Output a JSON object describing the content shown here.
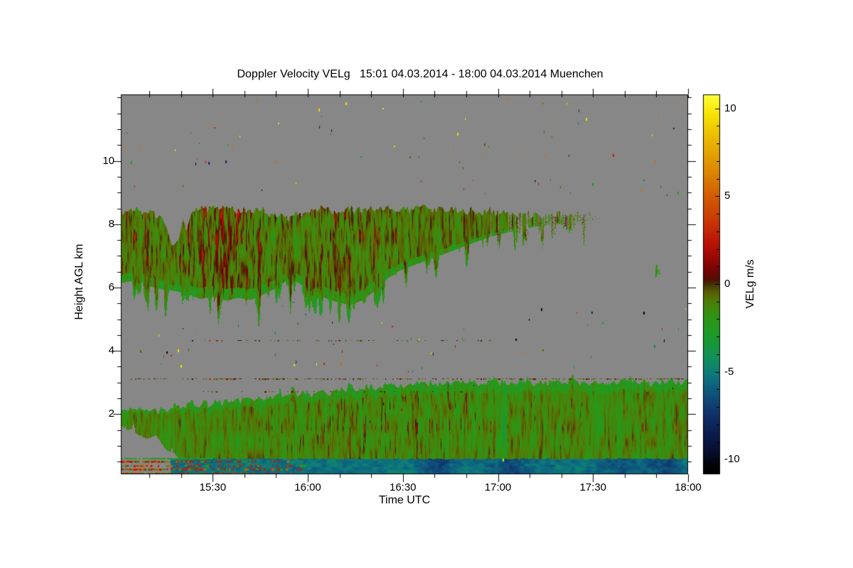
{
  "chart_data": {
    "type": "heatmap",
    "title": "Doppler Velocity VELg   15:01 04.03.2014 - 18:00 04.03.2014 Muenchen",
    "x_axis": {
      "label": "Time UTC",
      "start_time": "15:01",
      "end_time": "18:00",
      "duration_min": 179,
      "tick_labels": [
        "15:30",
        "16:00",
        "16:30",
        "17:00",
        "17:30",
        "18:00"
      ],
      "tick_min": [
        29,
        59,
        89,
        119,
        149,
        179
      ],
      "minor_step_min": 10
    },
    "y_axis": {
      "label": "Height AGL km",
      "min_km": 0.1,
      "max_km": 12.1,
      "tick_labels": [
        "2",
        "4",
        "6",
        "8",
        "10"
      ],
      "tick_km": [
        2,
        4,
        6,
        8,
        10
      ],
      "minor_step_km": 0.5
    },
    "colorbar": {
      "label": "VELg m/s",
      "vmin": -10.75,
      "vmax": 10.75,
      "tick_labels": [
        "10",
        "5",
        "0",
        "-5",
        "-10"
      ],
      "tick_values": [
        10,
        5,
        0,
        -5,
        -10
      ],
      "minor_step": 1
    },
    "no_data_color": "#878787",
    "colormap_stops": [
      [
        -10.75,
        "#000000"
      ],
      [
        -10.2,
        "#03040c"
      ],
      [
        -9.5,
        "#071030"
      ],
      [
        -8.5,
        "#0b1c4e"
      ],
      [
        -7.5,
        "#0f3068"
      ],
      [
        -6.5,
        "#0e4c78"
      ],
      [
        -5.5,
        "#0d6c80"
      ],
      [
        -5.0,
        "#0e7e76"
      ],
      [
        -4.2,
        "#11905c"
      ],
      [
        -3.4,
        "#16983a"
      ],
      [
        -2.6,
        "#1f9c22"
      ],
      [
        -1.8,
        "#2f9414"
      ],
      [
        -1.0,
        "#4f7e08"
      ],
      [
        -0.5,
        "#5a6203"
      ],
      [
        -0.15,
        "#4c4403"
      ],
      [
        0,
        "#452f08"
      ],
      [
        0.3,
        "#540e04"
      ],
      [
        0.8,
        "#740503"
      ],
      [
        1.6,
        "#9c0a04"
      ],
      [
        2.4,
        "#bc1406"
      ],
      [
        3.2,
        "#c62c07"
      ],
      [
        4.0,
        "#cc4204"
      ],
      [
        5.0,
        "#d25c00"
      ],
      [
        6.0,
        "#d97c00"
      ],
      [
        7.2,
        "#e29c00"
      ],
      [
        8.4,
        "#ecbc00"
      ],
      [
        9.6,
        "#f6e200"
      ],
      [
        10.75,
        "#ffff38"
      ]
    ],
    "layers": {
      "upper_cloud": {
        "t_end": 151,
        "fade_start": 113,
        "top_km": [
          [
            0,
            8.35
          ],
          [
            6,
            8.45
          ],
          [
            10,
            8.35
          ],
          [
            13,
            8.3
          ],
          [
            14.5,
            7.9
          ],
          [
            16,
            7.3
          ],
          [
            18,
            7.5
          ],
          [
            19.5,
            8.1
          ],
          [
            20.5,
            7.9
          ],
          [
            22,
            8.3
          ],
          [
            25,
            8.45
          ],
          [
            31,
            8.55
          ],
          [
            37,
            8.45
          ],
          [
            43,
            8.5
          ],
          [
            49,
            8.3
          ],
          [
            53,
            8.2
          ],
          [
            57,
            8.35
          ],
          [
            63,
            8.5
          ],
          [
            69,
            8.45
          ],
          [
            77,
            8.5
          ],
          [
            85,
            8.45
          ],
          [
            93,
            8.5
          ],
          [
            101,
            8.45
          ],
          [
            109,
            8.4
          ],
          [
            117,
            8.42
          ],
          [
            125,
            8.35
          ],
          [
            133,
            8.3
          ],
          [
            141,
            8.35
          ],
          [
            151,
            8.25
          ]
        ],
        "bottom_km": [
          [
            0,
            6.15
          ],
          [
            5,
            6.25
          ],
          [
            9,
            6.05
          ],
          [
            13,
            5.95
          ],
          [
            17,
            5.9
          ],
          [
            21,
            5.8
          ],
          [
            25,
            5.65
          ],
          [
            29,
            5.72
          ],
          [
            33,
            5.6
          ],
          [
            37,
            5.68
          ],
          [
            41,
            5.62
          ],
          [
            45,
            5.8
          ],
          [
            49,
            6.0
          ],
          [
            53,
            6.3
          ],
          [
            56,
            6.15
          ],
          [
            60,
            5.85
          ],
          [
            64,
            5.7
          ],
          [
            68,
            5.55
          ],
          [
            72,
            5.45
          ],
          [
            76,
            5.6
          ],
          [
            80,
            5.9
          ],
          [
            84,
            6.3
          ],
          [
            88,
            6.55
          ],
          [
            92,
            6.7
          ],
          [
            96,
            6.85
          ],
          [
            100,
            7.0
          ],
          [
            104,
            7.15
          ],
          [
            108,
            7.3
          ],
          [
            112,
            7.45
          ],
          [
            116,
            7.6
          ],
          [
            120,
            7.7
          ],
          [
            126,
            7.85
          ],
          [
            132,
            7.95
          ],
          [
            138,
            8.0
          ],
          [
            144,
            8.08
          ],
          [
            151,
            8.18
          ]
        ],
        "redness": [
          [
            0,
            0.55
          ],
          [
            8,
            0.62
          ],
          [
            14,
            0.45
          ],
          [
            18,
            0.5
          ],
          [
            24,
            0.68
          ],
          [
            30,
            0.75
          ],
          [
            36,
            0.72
          ],
          [
            42,
            0.6
          ],
          [
            48,
            0.42
          ],
          [
            54,
            0.38
          ],
          [
            58,
            0.5
          ],
          [
            64,
            0.62
          ],
          [
            70,
            0.66
          ],
          [
            76,
            0.6
          ],
          [
            82,
            0.5
          ],
          [
            88,
            0.48
          ],
          [
            94,
            0.4
          ],
          [
            102,
            0.34
          ],
          [
            112,
            0.36
          ],
          [
            124,
            0.32
          ],
          [
            136,
            0.36
          ],
          [
            150,
            0.3
          ]
        ]
      },
      "lower_layer": {
        "top_km": [
          [
            0,
            2.1
          ],
          [
            6,
            2.15
          ],
          [
            12,
            2.1
          ],
          [
            18,
            2.2
          ],
          [
            24,
            2.3
          ],
          [
            30,
            2.35
          ],
          [
            36,
            2.45
          ],
          [
            42,
            2.5
          ],
          [
            48,
            2.55
          ],
          [
            54,
            2.62
          ],
          [
            60,
            2.65
          ],
          [
            66,
            2.72
          ],
          [
            72,
            2.8
          ],
          [
            78,
            2.85
          ],
          [
            84,
            2.9
          ],
          [
            90,
            2.95
          ],
          [
            96,
            2.95
          ],
          [
            102,
            3.0
          ],
          [
            110,
            3.0
          ],
          [
            120,
            3.02
          ],
          [
            130,
            3.0
          ],
          [
            140,
            3.02
          ],
          [
            150,
            3.0
          ],
          [
            160,
            3.02
          ],
          [
            170,
            3.0
          ],
          [
            179,
            3.05
          ]
        ],
        "bottom_km": [
          [
            0,
            1.6
          ],
          [
            4,
            1.45
          ],
          [
            8,
            1.2
          ],
          [
            11,
            1.35
          ],
          [
            14,
            0.9
          ],
          [
            16,
            0.75
          ],
          [
            19,
            0.6
          ],
          [
            23,
            0.25
          ],
          [
            27,
            0.05
          ],
          [
            179,
            0.02
          ]
        ],
        "redness": [
          [
            0,
            0.42
          ],
          [
            10,
            0.3
          ],
          [
            20,
            0.28
          ],
          [
            35,
            0.32
          ],
          [
            50,
            0.45
          ],
          [
            60,
            0.52
          ],
          [
            75,
            0.55
          ],
          [
            90,
            0.5
          ],
          [
            105,
            0.45
          ],
          [
            120,
            0.4
          ],
          [
            140,
            0.33
          ],
          [
            160,
            0.3
          ],
          [
            179,
            0.36
          ]
        ],
        "teal_streaks": [
          [
            120.7,
            1.8,
            2.6
          ],
          [
            150,
            2.5,
            1.1
          ]
        ]
      },
      "surface_band": {
        "t_start": 15.5,
        "top_km": 0.6,
        "bottom_km": 0.14,
        "base_value": -4.4,
        "dark_patches": [
          [
            100,
            8,
            2.2
          ],
          [
            123,
            9,
            1.8
          ],
          [
            158,
            11,
            1.3
          ],
          [
            171,
            7,
            2.0
          ]
        ]
      },
      "clutter": {
        "t_end": 58,
        "row_km": [
          0.52,
          0.4,
          0.27,
          0.15,
          0.06
        ],
        "green_line_km": 0.62
      },
      "dash_rows": [
        {
          "km": 4.35,
          "t0": 21,
          "t1": 120,
          "density": 0.3
        },
        {
          "km": 3.12,
          "t0": 0,
          "t1": 179,
          "density": 0.55
        },
        {
          "km": 2.72,
          "t0": 26,
          "t1": 112,
          "density": 0.2
        }
      ],
      "specks": {
        "count": 150
      },
      "isolated_patch": {
        "t": 169.3,
        "km": 6.5
      }
    }
  }
}
